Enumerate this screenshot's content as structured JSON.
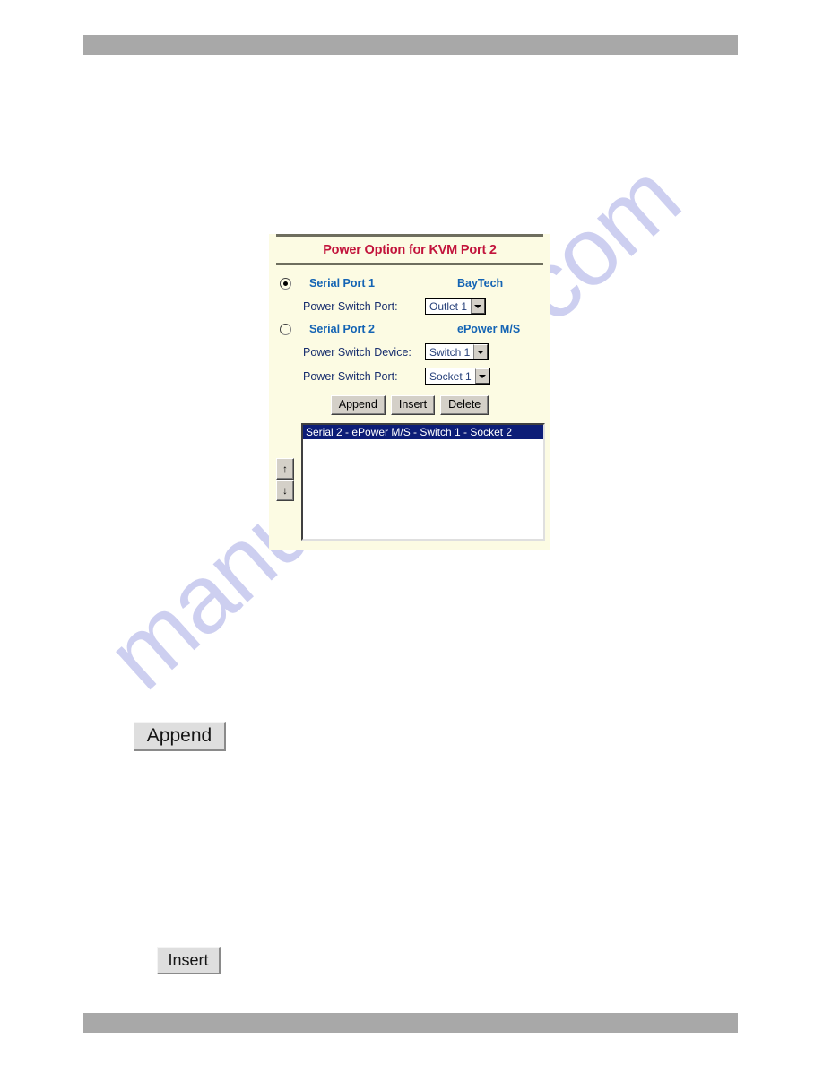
{
  "page": {
    "header_bar": "",
    "footer_bar": ""
  },
  "watermark": {
    "text": "manualshive.com"
  },
  "panel": {
    "title": "Power Option for KVM Port 2",
    "options": [
      {
        "radio_name": "serial-port-1",
        "selected": true,
        "port_label": "Serial Port 1",
        "device_label": "BayTech",
        "fields": [
          {
            "label": "Power Switch Port:",
            "select_name": "power-switch-port-select-1",
            "value": "Outlet 1"
          }
        ]
      },
      {
        "radio_name": "serial-port-2",
        "selected": false,
        "port_label": "Serial Port 2",
        "device_label": "ePower M/S",
        "fields": [
          {
            "label": "Power Switch Device:",
            "select_name": "power-switch-device-select",
            "value": "Switch 1"
          },
          {
            "label": "Power Switch Port:",
            "select_name": "power-switch-port-select-2",
            "value": "Socket 1"
          }
        ]
      }
    ],
    "buttons": {
      "append": "Append",
      "insert": "Insert",
      "delete": "Delete"
    },
    "arrows": {
      "up": "↑",
      "down": "↓"
    },
    "list": {
      "items": [
        {
          "text": "Serial 2 - ePower M/S - Switch 1 - Socket 2",
          "selected": true
        }
      ]
    }
  },
  "figure_buttons": {
    "append": "Append",
    "insert": "Insert"
  },
  "colors": {
    "panel_background": "#fcfbe3",
    "title_text": "#c2143c",
    "link_blue": "#1464b4",
    "label_navy": "#182e6e",
    "selection_navy": "#0c1d77",
    "bar_gray": "#a8a8a8",
    "watermark": "#c7c9ee"
  }
}
